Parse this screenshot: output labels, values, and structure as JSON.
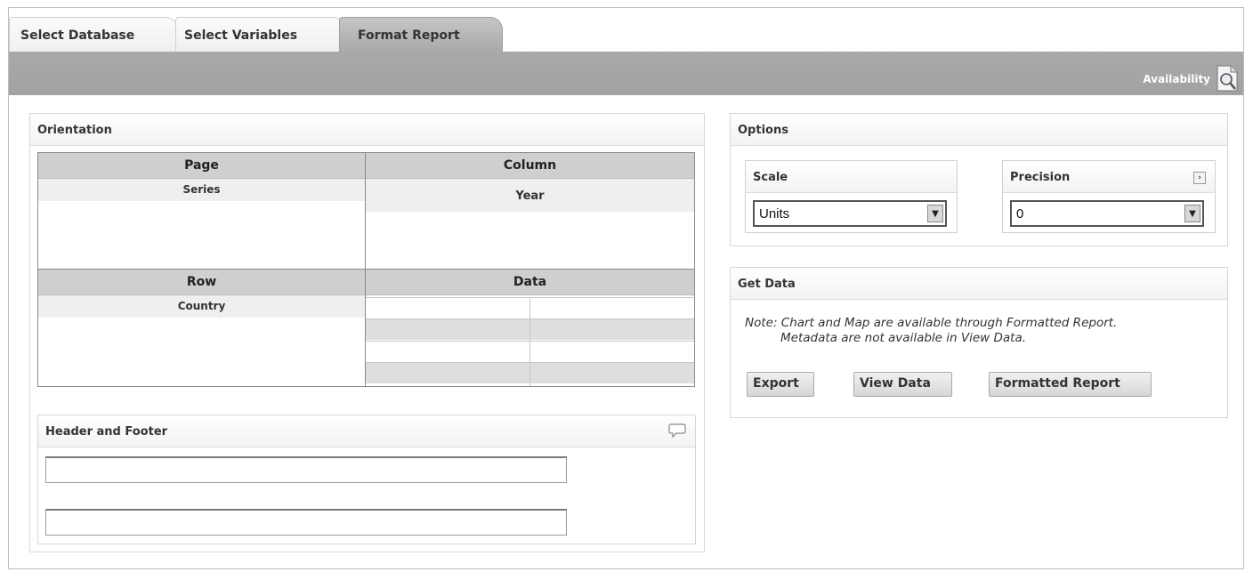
{
  "tabs": [
    {
      "label": "Select Database"
    },
    {
      "label": "Select Variables"
    },
    {
      "label": "Format Report"
    }
  ],
  "toolbar": {
    "availability_label": "Availability",
    "icon": "magnifier-document-icon"
  },
  "orientation": {
    "title": "Orientation",
    "page": {
      "header": "Page",
      "items": [
        "Series"
      ]
    },
    "column": {
      "header": "Column",
      "items": [
        "Year"
      ]
    },
    "row": {
      "header": "Row",
      "items": [
        "Country"
      ]
    },
    "data": {
      "header": "Data"
    }
  },
  "header_footer": {
    "title": "Header and Footer",
    "header_value": "",
    "footer_value": "",
    "icon": "comment-icon"
  },
  "options": {
    "title": "Options",
    "scale": {
      "label": "Scale",
      "selected": "Units"
    },
    "precision": {
      "label": "Precision",
      "selected": "0"
    }
  },
  "get_data": {
    "title": "Get Data",
    "note_line1": "Note: Chart and Map are available through Formatted Report.",
    "note_line2": "Metadata are not available in View Data.",
    "buttons": {
      "export": "Export",
      "view": "View Data",
      "formatted": "Formatted Report"
    }
  }
}
